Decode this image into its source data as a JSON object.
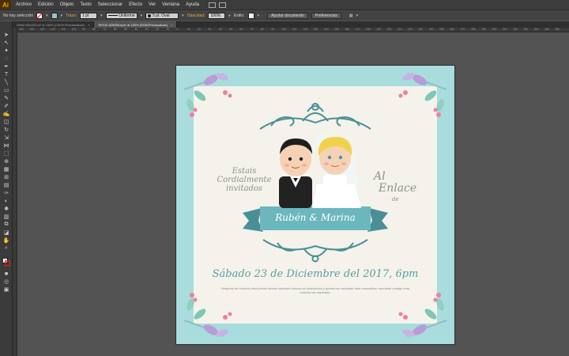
{
  "app": {
    "logo": "Ai",
    "menu": [
      "Archivo",
      "Edición",
      "Objeto",
      "Texto",
      "Seleccionar",
      "Efecto",
      "Ver",
      "Ventana",
      "Ayuda"
    ]
  },
  "control_bar": {
    "selection": "No hay selección",
    "stroke_label": "Trazo:",
    "stroke_value": "1 pt",
    "profile": "Uniforme",
    "brush": "5 pt. Oval",
    "opacity_label": "Opacidad:",
    "opacity_value": "100%",
    "style_label": "Estilo:",
    "doc_setup_button": "Ajustar documento",
    "preferences_button": "Preferencias"
  },
  "tabs": [
    {
      "label": "WeW-NS0225.ai* al 150% (CMYK/Previsualizar)",
      "active": false
    },
    {
      "label": "RESIZ-029558.eps* al 100% (RGB/Previsualizar)",
      "active": true
    }
  ],
  "ruler_ticks": [
    "150",
    "140",
    "130",
    "120",
    "110",
    "100",
    "90",
    "80",
    "70",
    "60",
    "50",
    "40",
    "30",
    "20",
    "10",
    "0",
    "10",
    "20",
    "30",
    "40",
    "50",
    "60",
    "70",
    "80",
    "90",
    "100",
    "110",
    "120",
    "130",
    "140",
    "150",
    "160",
    "170",
    "180",
    "190",
    "200",
    "210",
    "220",
    "230",
    "240",
    "250",
    "260",
    "270",
    "280",
    "290",
    "300",
    "310",
    "320",
    "330",
    "340",
    "350",
    "360"
  ],
  "colors": {
    "ui_dark": "#3c3c3c",
    "canvas": "#535353",
    "card_border": "#a9dcdc",
    "card_paper": "#f4f2eb",
    "ornament": "#4b8f96",
    "ribbon": "#6bb7bd",
    "accent_text": "#5d9ea2"
  },
  "card": {
    "invite_left": "Estais Cordialmente invitados",
    "al": "Al",
    "enlace": "Enlace",
    "de": "de",
    "names": "Rubén & Marina",
    "date": "Sábado 23 de Diciembre del 2017, 6pm",
    "description": "Después de muchos años juntos hemos decidido unirnos en matrimonio y queremos compartir este maravilloso momento contigo esta ocasión tan esperada."
  }
}
